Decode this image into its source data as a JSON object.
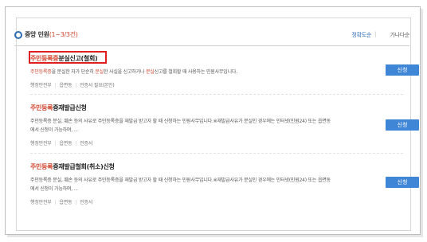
{
  "header": {
    "title": "중앙 민원",
    "count": "(1~3/3건)",
    "sort_accuracy": "정확도순",
    "sort_separator": "|",
    "sort_alpha": "가나다순"
  },
  "results": [
    {
      "name_red": "주민등록증",
      "name_rest": "분실신고(철회)",
      "desc_parts": [
        "주민등록증",
        "을 분실한 자가 단순히 ",
        "분실",
        "한 사실을 신고하거나 ",
        "분실",
        "신고를 철회할 때 사용하는 민원사무입니다."
      ],
      "meta": [
        "행정안전부",
        "읍면동",
        "인증서 필요(본인)"
      ],
      "button": "신청"
    },
    {
      "name_red": "주민등록",
      "name_rest": "증재발급신청",
      "desc": "주민등록증 분실, 훼손 등의 사유로 주민등록증을 재발급 받고자 할 때 신청하는 민원사무입니다.※재발급사유가 분실인 경우에는 인터넷(민원24) 또는 읍면동에서 신청이 가능하며, ...",
      "meta": [
        "행정안전부",
        "읍면동",
        "인증서"
      ],
      "button": "신청"
    },
    {
      "name_red": "주민등록",
      "name_rest": "증재발급철회(취소)신청",
      "desc": "주민등록증 분실, 훼손 등의 사유로 주민등록증을 재발급 받고자 할 때 신청하는 민원사무입니다.※재발급사유가 분실인 경우에는 인터넷(민원24) 또는 읍면동에서 신청이 가능하며, ...",
      "meta": [
        "행정안전부",
        "읍면동",
        "인증서"
      ],
      "button": "신청"
    }
  ]
}
